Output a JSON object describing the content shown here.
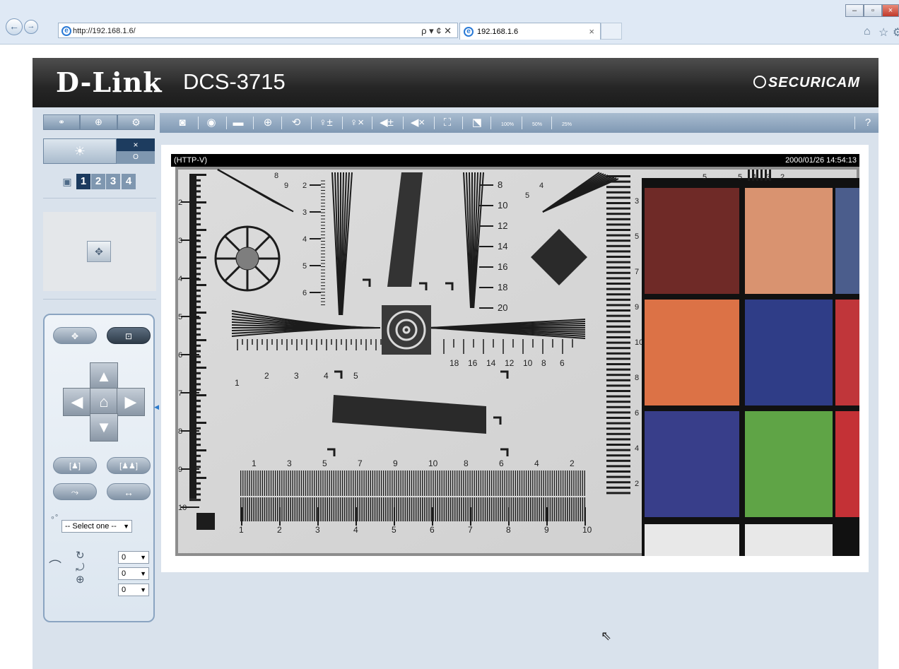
{
  "browser": {
    "url": "http://192.168.1.6/",
    "tab_title": "192.168.1.6",
    "tab_close": "×",
    "addr_tools": "ρ ▾ ¢ ✕"
  },
  "header": {
    "logo": "D-Link",
    "model": "DCS-3715",
    "brand": "SECURICAM"
  },
  "toolbar": {
    "help": "?",
    "zoom_labels": [
      "100%",
      "50%",
      "25%"
    ]
  },
  "left": {
    "profiles": [
      "1",
      "2",
      "3",
      "4"
    ],
    "alarm_close": "×",
    "alarm_state": "O",
    "preset_select": "-- Select one --",
    "speed_selects": [
      "0",
      "0",
      "0"
    ]
  },
  "video": {
    "stream_label": "(HTTP-V)",
    "timestamp": "2000/01/26 14:54:13"
  },
  "colors": {
    "header_bg": "#262626",
    "toolbar_bg": "#8fa6be",
    "page_bg": "#d9e2ec",
    "profile_active": "#1b3a5e",
    "profile_inactive": "#7f97b0"
  },
  "test_chart": {
    "left_scale": [
      "2",
      "3",
      "4",
      "5",
      "6",
      "7",
      "8",
      "9",
      "10"
    ],
    "top_left_scale": [
      "8",
      "9"
    ],
    "wedge_left": [
      "2",
      "3",
      "4",
      "5",
      "6"
    ],
    "wedge_right": [
      "8",
      "10",
      "12",
      "14",
      "16",
      "18",
      "20"
    ],
    "h_left": [
      "1",
      "2",
      "3",
      "4",
      "5"
    ],
    "h_right": [
      "18",
      "16",
      "14",
      "12",
      "10",
      "8",
      "6"
    ],
    "bottom_top": [
      "1",
      "3",
      "5",
      "7",
      "9",
      "10",
      "8",
      "6",
      "4",
      "2"
    ],
    "bottom_scale": [
      "1",
      "2",
      "3",
      "4",
      "5",
      "6",
      "7",
      "8",
      "9",
      "10"
    ],
    "right_wedge": [
      "3",
      "5",
      "7",
      "9",
      "10",
      "8",
      "6",
      "4",
      "2"
    ],
    "top_right": [
      "5",
      "5",
      "4",
      "3",
      "2"
    ],
    "top_right_small": [
      "4",
      "5"
    ]
  }
}
